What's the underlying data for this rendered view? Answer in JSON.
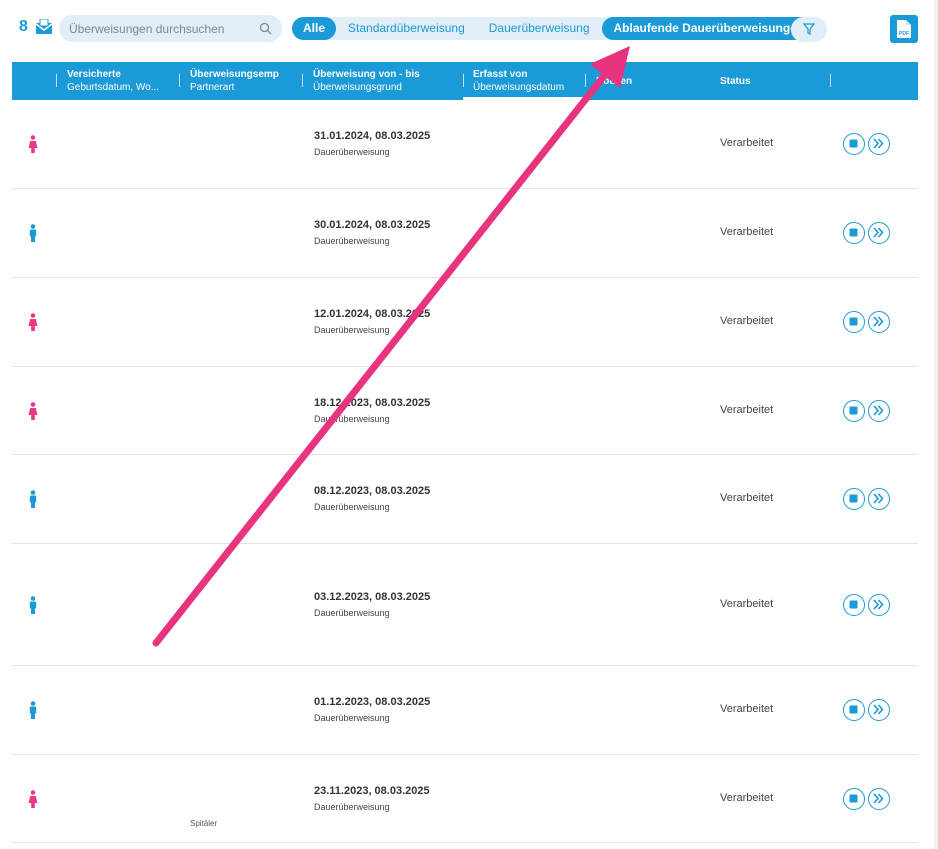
{
  "toolbar": {
    "count": "8",
    "search_placeholder": "Überweisungen durchsuchen",
    "tabs": [
      {
        "label": "Alle"
      },
      {
        "label": "Standardüberweisung"
      },
      {
        "label": "Dauerüberweisung"
      },
      {
        "label": "Ablaufende Dauerüberweisungen"
      }
    ],
    "active_tab": "Ablaufende Dauerüberweisungen",
    "pdf_label": "PDF"
  },
  "table": {
    "columns": [
      {
        "title": "Versicherte",
        "subtitle": "Geburtsdatum, Wo..."
      },
      {
        "title": "Überweisungsemp",
        "subtitle": "Partnerart"
      },
      {
        "title": "Überweisung von - bis",
        "subtitle": "Überweisungsgrund"
      },
      {
        "title": "Erfasst von",
        "subtitle": "Überweisungsdatum"
      },
      {
        "title": "Notizen",
        "subtitle": ""
      },
      {
        "title": "Status",
        "subtitle": ""
      }
    ],
    "rows": [
      {
        "gender": "female",
        "period": "31.01.2024, 08.03.2025",
        "reason": "Dauerüberweisung",
        "status": "Verarbeitet"
      },
      {
        "gender": "male",
        "period": "30.01.2024, 08.03.2025",
        "reason": "Dauerüberweisung",
        "status": "Verarbeitet"
      },
      {
        "gender": "female",
        "period": "12.01.2024, 08.03.2025",
        "reason": "Dauerüberweisung",
        "status": "Verarbeitet"
      },
      {
        "gender": "female",
        "period": "18.12.2023, 08.03.2025",
        "reason": "Dauerüberweisung",
        "status": "Verarbeitet"
      },
      {
        "gender": "male",
        "period": "08.12.2023, 08.03.2025",
        "reason": "Dauerüberweisung",
        "status": "Verarbeitet"
      },
      {
        "gender": "male",
        "period": "03.12.2023, 08.03.2025",
        "reason": "Dauerüberweisung",
        "status": "Verarbeitet"
      },
      {
        "gender": "male",
        "period": "01.12.2023, 08.03.2025",
        "reason": "Dauerüberweisung",
        "status": "Verarbeitet"
      },
      {
        "gender": "female",
        "period": "23.11.2023, 08.03.2025",
        "reason": "Dauerüberweisung",
        "status": "Verarbeitet"
      }
    ],
    "last_row_partner_type": "Spitäler"
  },
  "colors": {
    "accent": "#1a9ad6",
    "female": "#e8388a",
    "male": "#1a9ad6",
    "annotation_arrow": "#e8337f"
  }
}
